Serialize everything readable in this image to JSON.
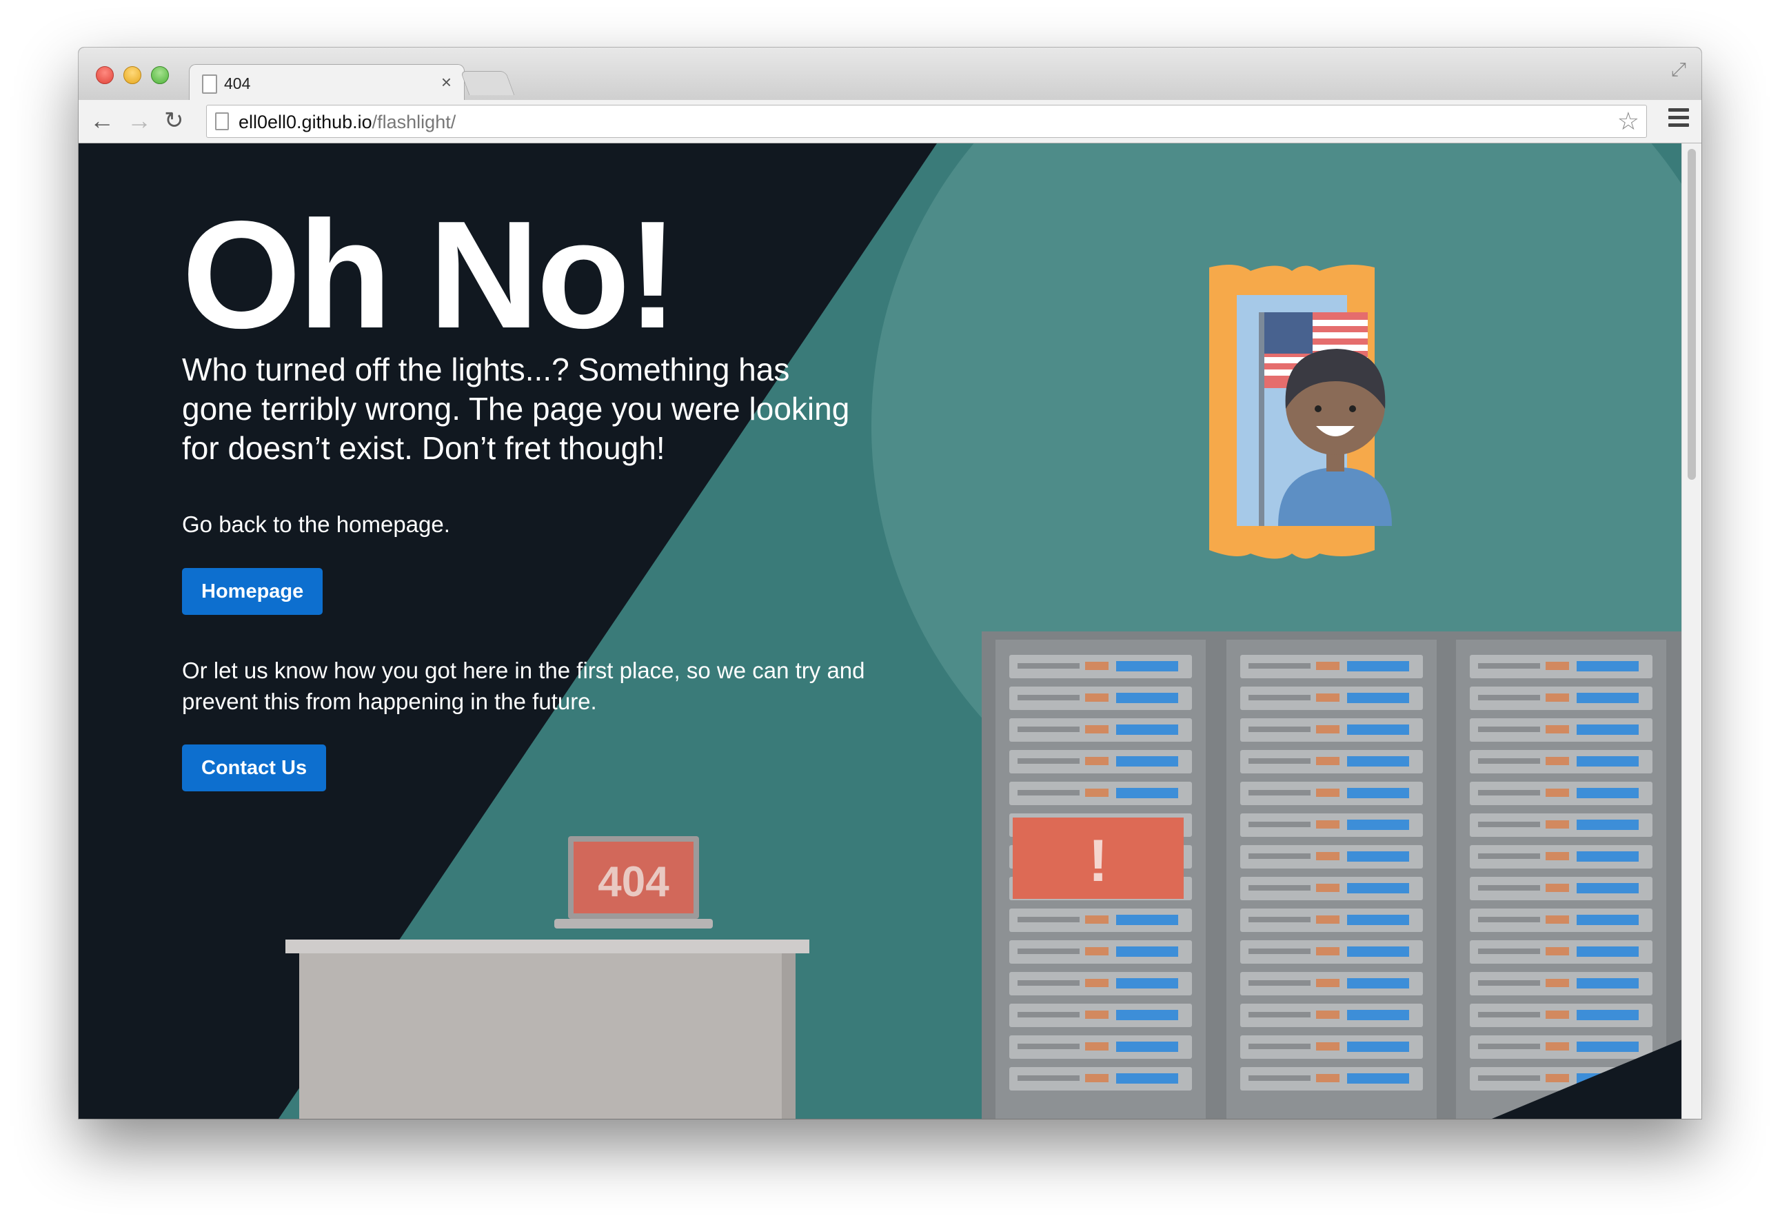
{
  "browser": {
    "tab_title": "404",
    "tab_close": "×",
    "url_host": "ell0ell0.github.io",
    "url_path": "/flashlight/",
    "back_glyph": "←",
    "forward_glyph": "→",
    "reload_glyph": "↻",
    "star_glyph": "☆",
    "fullscreen_glyph": "⤢"
  },
  "page": {
    "heading": "Oh No!",
    "lead": "Who turned off the lights...? Something has gone terribly wrong. The page you were looking for doesn’t exist. Don’t fret though!",
    "homepage_prompt": "Go back to the homepage.",
    "homepage_button": "Homepage",
    "contact_prompt": "Or let us know how you got here in the first place, so we can try and prevent this from happening in the future.",
    "contact_button": "Contact Us",
    "laptop_screen_text": "404",
    "alert_symbol": "!"
  },
  "colors": {
    "dark_bg": "#111820",
    "spotlight": "#3a7b79",
    "spotlight_inner": "#4e8c89",
    "button": "#0d6fcf",
    "frame": "#f6a94a",
    "alert": "#dd6a55"
  }
}
